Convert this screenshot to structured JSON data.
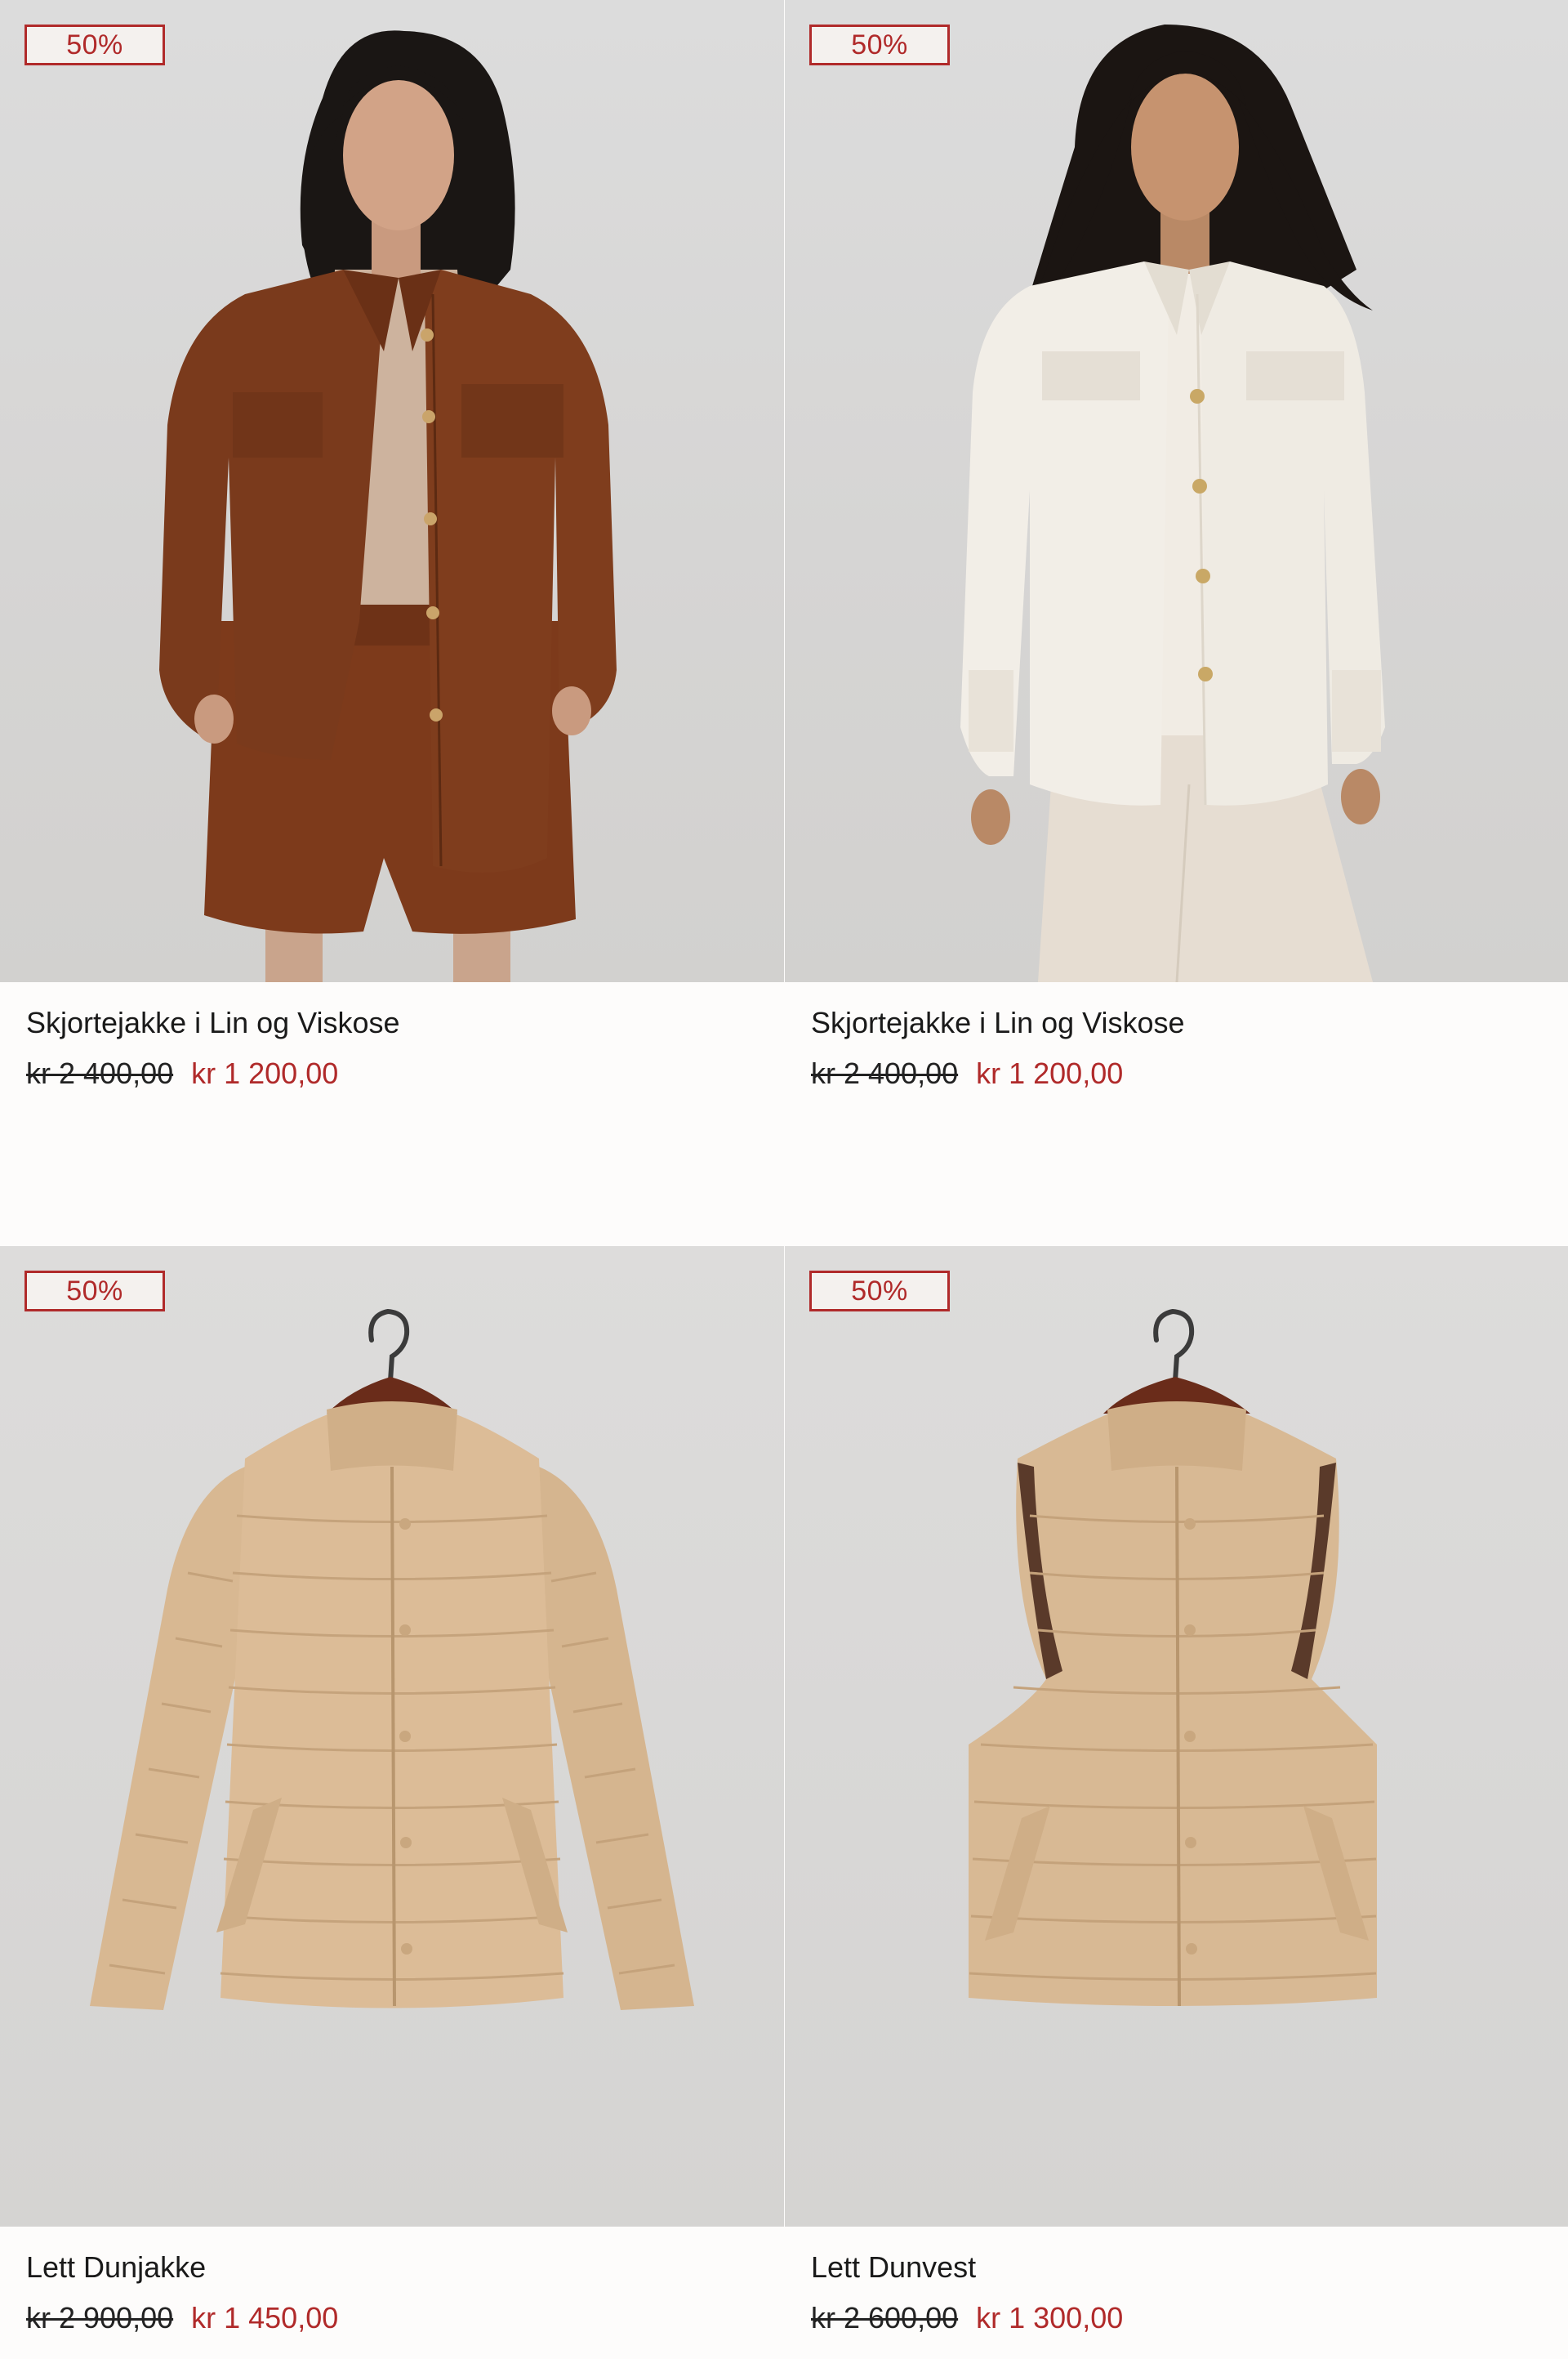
{
  "products": [
    {
      "badge": "50%",
      "title": "Skjortejakke i Lin og Viskose",
      "old_price": "kr 2 400,00",
      "new_price": "kr 1 200,00",
      "image": "model-brown-linen-shirt-jacket"
    },
    {
      "badge": "50%",
      "title": "Skjortejakke i Lin og Viskose",
      "old_price": "kr 2 400,00",
      "new_price": "kr 1 200,00",
      "image": "model-white-linen-shirt-jacket"
    },
    {
      "badge": "50%",
      "title": "Lett Dunjakke",
      "old_price": "kr 2 900,00",
      "new_price": "kr 1 450,00",
      "image": "beige-down-jacket-on-hanger"
    },
    {
      "badge": "50%",
      "title": "Lett Dunvest",
      "old_price": "kr 2 600,00",
      "new_price": "kr 1 300,00",
      "image": "beige-down-vest-on-hanger"
    }
  ],
  "colors": {
    "sale_red": "#b02a2a",
    "background": "#fdfcfb",
    "brown_jacket": "#7a3a1c",
    "white_jacket": "#f2eee7",
    "down_beige": "#d9b994"
  }
}
